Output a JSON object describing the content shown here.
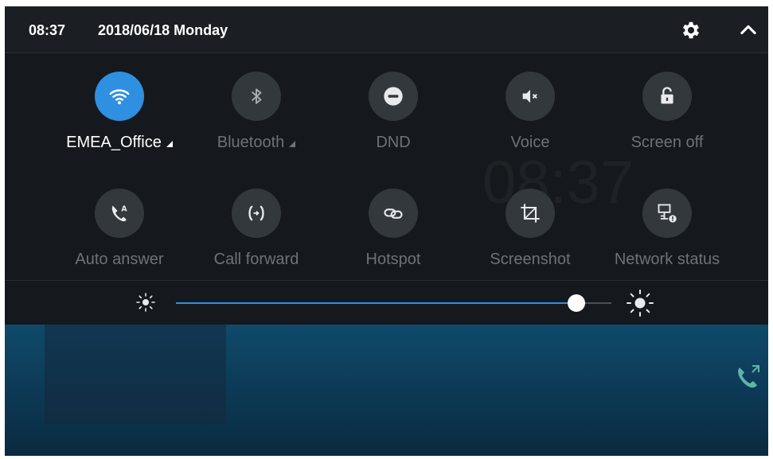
{
  "status": {
    "time": "08:37",
    "date": "2018/06/18 Monday"
  },
  "icons": {
    "settings": "gear-icon",
    "collapse": "chevron-up-icon"
  },
  "tiles": [
    {
      "label": "EMEA_Office",
      "icon": "wifi-icon",
      "active": true,
      "expandable": true
    },
    {
      "label": "Bluetooth",
      "icon": "bluetooth-icon",
      "active": false,
      "expandable": true
    },
    {
      "label": "DND",
      "icon": "dnd-icon",
      "active": false,
      "expandable": false
    },
    {
      "label": "Voice",
      "icon": "volume-mute-icon",
      "active": false,
      "expandable": false
    },
    {
      "label": "Screen off",
      "icon": "lock-icon",
      "active": false,
      "expandable": false
    },
    {
      "label": "Auto answer",
      "icon": "auto-answer-icon",
      "active": false,
      "expandable": false
    },
    {
      "label": "Call forward",
      "icon": "call-forward-icon",
      "active": false,
      "expandable": false
    },
    {
      "label": "Hotspot",
      "icon": "hotspot-icon",
      "active": false,
      "expandable": false
    },
    {
      "label": "Screenshot",
      "icon": "crop-icon",
      "active": false,
      "expandable": false
    },
    {
      "label": "Network status",
      "icon": "network-status-icon",
      "active": false,
      "expandable": false
    }
  ],
  "brightness": {
    "level": 0.92
  },
  "colors": {
    "accent": "#2f8fe0",
    "inactive_circle": "#33383d",
    "inactive_text": "#6c7278"
  }
}
